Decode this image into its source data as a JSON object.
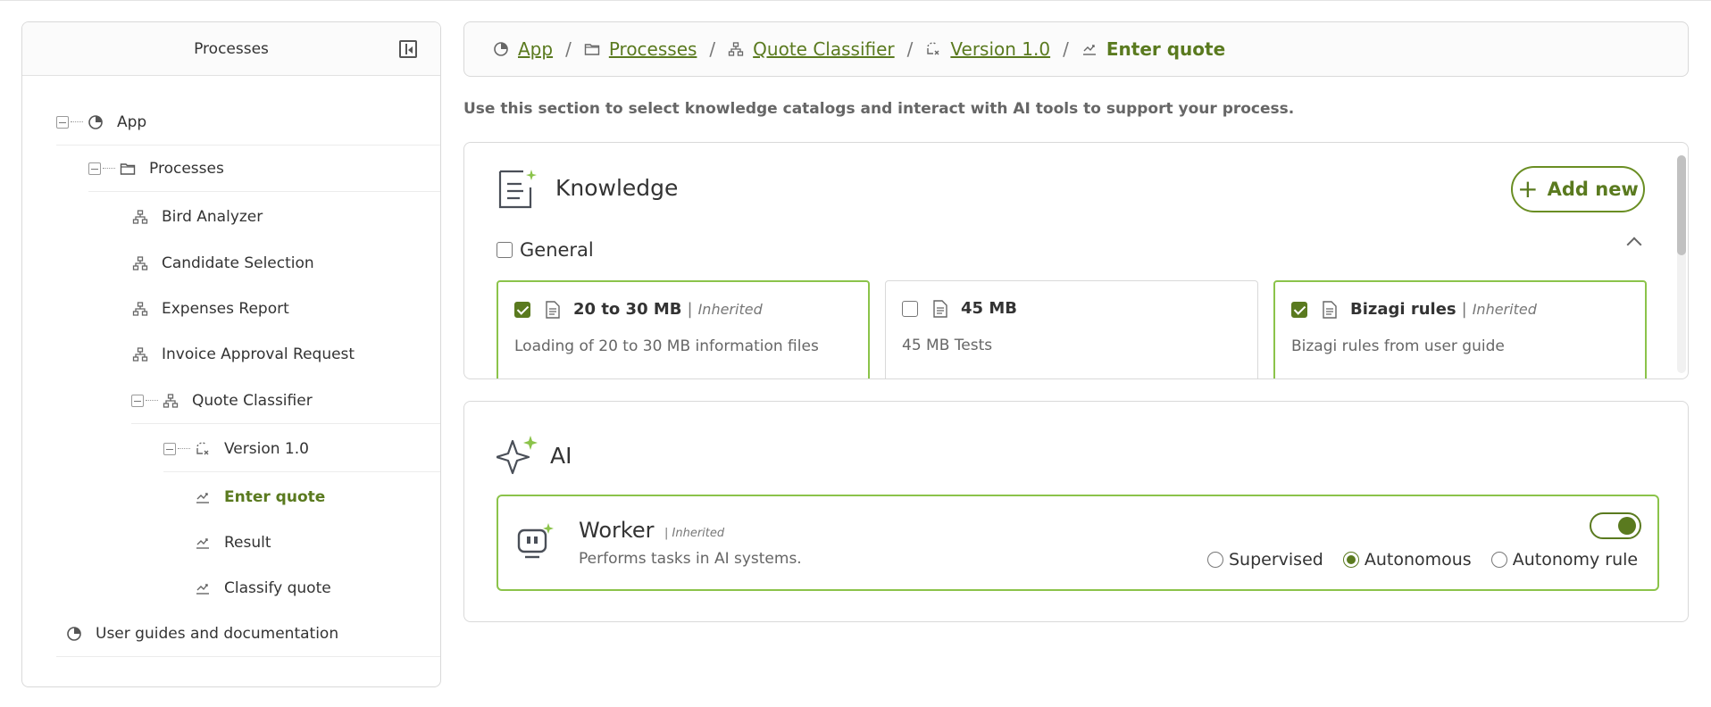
{
  "sidebar": {
    "title": "Processes",
    "items": [
      {
        "label": "App",
        "icon": "app-icon"
      },
      {
        "label": "Processes",
        "icon": "folder-icon"
      },
      {
        "label": "Bird Analyzer",
        "icon": "process-icon"
      },
      {
        "label": "Candidate Selection",
        "icon": "process-icon"
      },
      {
        "label": "Expenses Report",
        "icon": "process-icon"
      },
      {
        "label": "Invoice Approval Request",
        "icon": "process-icon"
      },
      {
        "label": "Quote Classifier",
        "icon": "process-icon"
      },
      {
        "label": "Version 1.0",
        "icon": "version-icon"
      },
      {
        "label": "Enter quote",
        "icon": "task-icon",
        "selected": true
      },
      {
        "label": "Result",
        "icon": "task-icon"
      },
      {
        "label": "Classify quote",
        "icon": "task-icon"
      },
      {
        "label": "User guides and documentation",
        "icon": "app-icon"
      }
    ]
  },
  "breadcrumb": {
    "items": [
      "App",
      "Processes",
      "Quote Classifier",
      "Version 1.0"
    ],
    "separator": "/",
    "current": "Enter quote"
  },
  "help_text": "Use this section to select knowledge catalogs and interact with AI tools to support your process.",
  "knowledge": {
    "title": "Knowledge",
    "add_label": "Add new",
    "group_label": "General",
    "cards": [
      {
        "name": "20 to 30 MB",
        "tag": "Inherited",
        "desc": "Loading of 20 to 30 MB information files",
        "checked": true
      },
      {
        "name": "45 MB",
        "tag": "",
        "desc": "45 MB Tests",
        "checked": false
      },
      {
        "name": "Bizagi rules",
        "tag": "Inherited",
        "desc": "Bizagi rules from user guide",
        "checked": true
      }
    ]
  },
  "ai": {
    "title": "AI",
    "worker": {
      "name": "Worker",
      "tag": "Inherited",
      "desc": "Performs tasks in AI systems.",
      "enabled": true,
      "modes": [
        "Supervised",
        "Autonomous",
        "Autonomy rule"
      ],
      "selected_mode": "Autonomous"
    }
  },
  "colors": {
    "accent": "#5a7a1f",
    "selected_border": "#8bc34a",
    "border": "#d9d9d9",
    "text": "#333333"
  }
}
